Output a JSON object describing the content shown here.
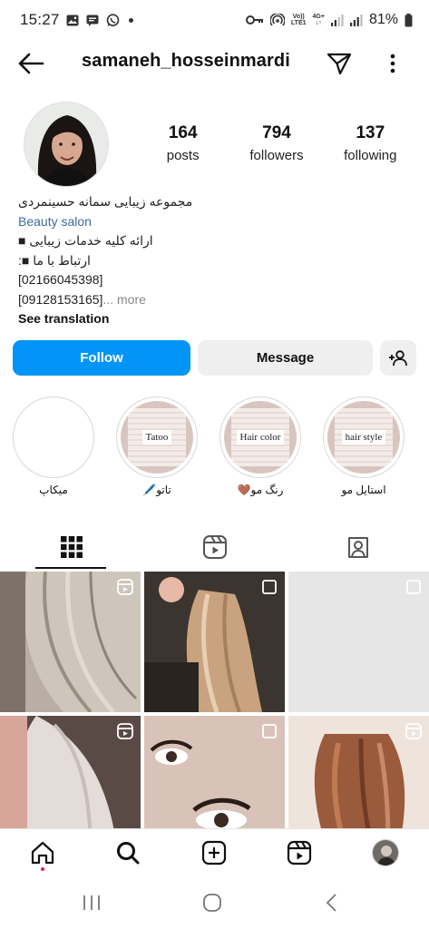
{
  "status_bar": {
    "time": "15:27",
    "battery": "81%",
    "network_top": "Vo))",
    "network_bottom": "LTE1",
    "data_top": "4G+",
    "data_bottom": "↓↑"
  },
  "header": {
    "username": "samaneh_hosseinmardi"
  },
  "stats": [
    {
      "count": "164",
      "label": "posts"
    },
    {
      "count": "794",
      "label": "followers"
    },
    {
      "count": "137",
      "label": "following"
    }
  ],
  "bio": {
    "name": "مجموعه زیبایی سمانه حسینمردی",
    "category": "Beauty salon",
    "line1": "ارائه کلیه خدمات زیبایی ■",
    "line2": "ارتباط با ما ■:",
    "phone1": "[02166045398]",
    "phone2": "[09128153165]",
    "more": "... more",
    "see_translation": "See translation"
  },
  "buttons": {
    "follow": "Follow",
    "message": "Message"
  },
  "highlights": [
    {
      "caption": "",
      "label": "میکاپ"
    },
    {
      "caption": "Tatoo",
      "label": "تاتو🖊️"
    },
    {
      "caption": "Hair color",
      "label": "رنگ مو🤎"
    },
    {
      "caption": "hair style",
      "label": "استایل مو"
    }
  ],
  "icons": {
    "back": "arrow-left-icon",
    "send": "paper-plane-icon",
    "more": "kebab-menu-icon",
    "add_user": "add-person-icon",
    "grid_tab": "grid-icon",
    "reels_tab": "reels-icon",
    "tagged_tab": "tagged-person-icon",
    "home": "home-icon",
    "search": "search-icon",
    "create": "plus-square-icon",
    "reels": "reels-icon"
  },
  "colors": {
    "follow_bg": "#0095f6",
    "button_bg": "#efefef",
    "category_link": "#3f6a9c"
  }
}
